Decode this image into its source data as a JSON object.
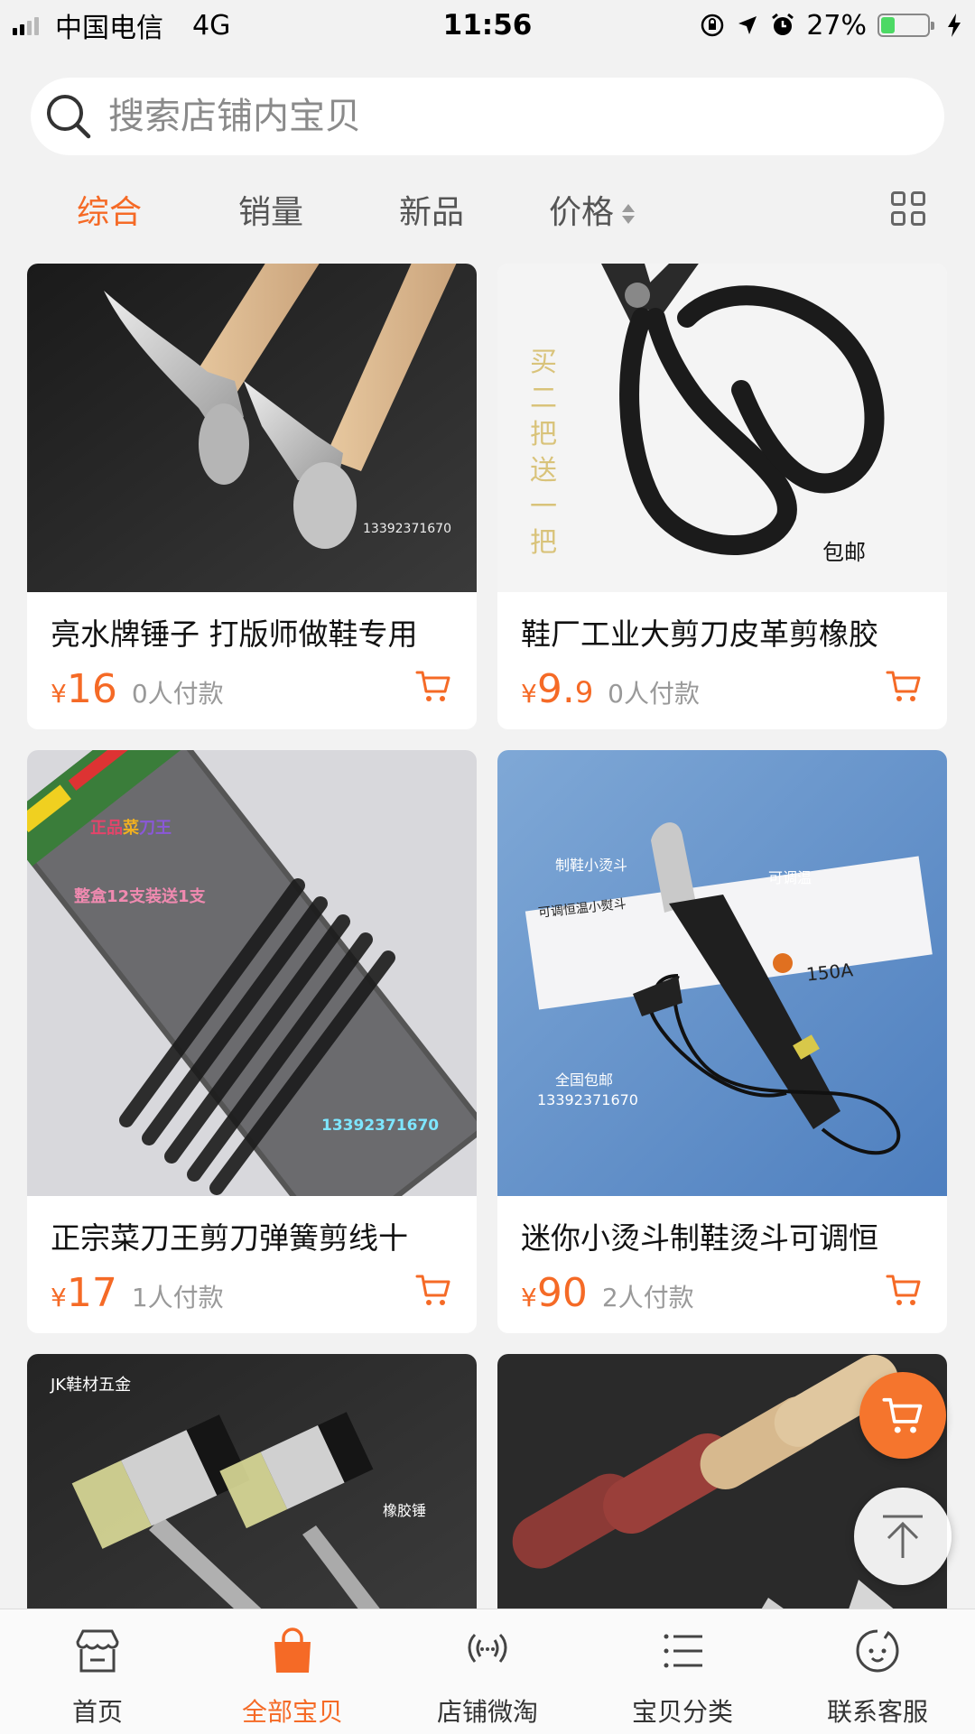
{
  "status_bar": {
    "carrier": "中国电信",
    "network": "4G",
    "time": "11:56",
    "battery": "27%",
    "battery_level": 0.27,
    "icons": [
      "rotation-lock-icon",
      "location-arrow-icon",
      "alarm-icon",
      "charging-bolt-icon"
    ]
  },
  "search": {
    "placeholder": "搜索店铺内宝贝"
  },
  "sort_tabs": [
    {
      "label": "综合",
      "active": true
    },
    {
      "label": "销量"
    },
    {
      "label": "新品"
    },
    {
      "label": "价格"
    }
  ],
  "products": [
    {
      "title": "亮水牌锤子 打版师做鞋专用",
      "yen": "¥",
      "price": "16",
      "price_decimal": "",
      "sold": "0人付款",
      "image_text": [
        "13392371670"
      ]
    },
    {
      "title": "鞋厂工业大剪刀皮革剪橡胶",
      "yen": "¥",
      "price": "9.",
      "price_decimal": "9",
      "sold": "0人付款",
      "image_text": [
        "买",
        "二",
        "把",
        "送",
        "一",
        "把",
        "包邮"
      ]
    },
    {
      "title": "正宗菜刀王剪刀弹簧剪线十",
      "yen": "¥",
      "price": "17",
      "price_decimal": "",
      "sold": "1人付款",
      "image_text": [
        "正品",
        "菜",
        "刀王",
        "整盒12支装送1支",
        "13392371670"
      ]
    },
    {
      "title": "迷你小烫斗制鞋烫斗可调恒",
      "yen": "¥",
      "price": "90",
      "price_decimal": "",
      "sold": "2人付款",
      "image_text": [
        "制鞋小烫斗",
        "可调温",
        "可调恒温小熨斗",
        "全国包邮",
        "13392371670",
        "150A"
      ]
    },
    {
      "image_text": [
        "JK鞋材五金",
        "橡胶锤"
      ]
    },
    {
      "image_text": []
    }
  ],
  "bottom_tabs": [
    {
      "label": "首页",
      "icon": "store-icon"
    },
    {
      "label": "全部宝贝",
      "icon": "shopping-bag-icon",
      "active": true
    },
    {
      "label": "店铺微淘",
      "icon": "broadcast-icon"
    },
    {
      "label": "宝贝分类",
      "icon": "list-icon"
    },
    {
      "label": "联系客服",
      "icon": "chat-face-icon"
    }
  ],
  "colors": {
    "accent": "#f56a26",
    "background": "#f2f2f2",
    "price": "#f56a26",
    "sold": "#999999"
  }
}
